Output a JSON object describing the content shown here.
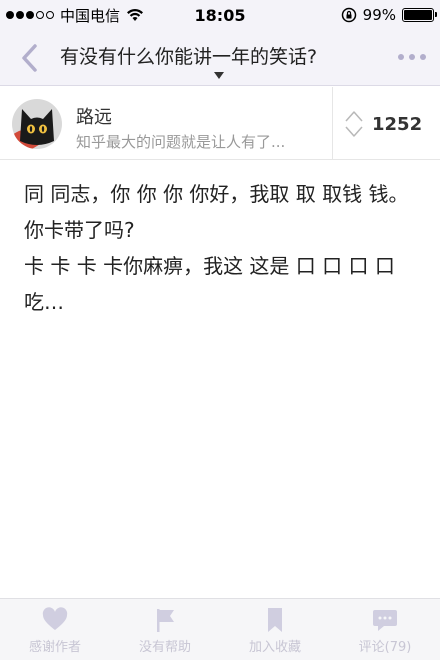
{
  "status_bar": {
    "carrier": "中国电信",
    "time": "18:05",
    "battery": "99%",
    "battery_level": 0.99,
    "signal_bars_filled": 3,
    "signal_bars_total": 5
  },
  "nav": {
    "title": "有没有什么你能讲一年的笑话?"
  },
  "author": {
    "name": "路远",
    "bio": "知乎最大的问题就是让人有了...",
    "votes": "1252"
  },
  "content": {
    "paragraphs": [
      "同 同志，你 你 你 你好，我取 取 取钱 钱。",
      "你卡带了吗?",
      "卡 卡 卡 卡你麻痹，我这 这是 口 口 口 口吃…"
    ]
  },
  "toolbar": {
    "thank_label": "感谢作者",
    "no_help_label": "没有帮助",
    "collect_label": "加入收藏",
    "comment_label": "评论(79)"
  },
  "colors": {
    "accent": "#b2aecc",
    "bar_bg": "#f4f3f9",
    "toolbar_icon": "#d0cee0"
  }
}
